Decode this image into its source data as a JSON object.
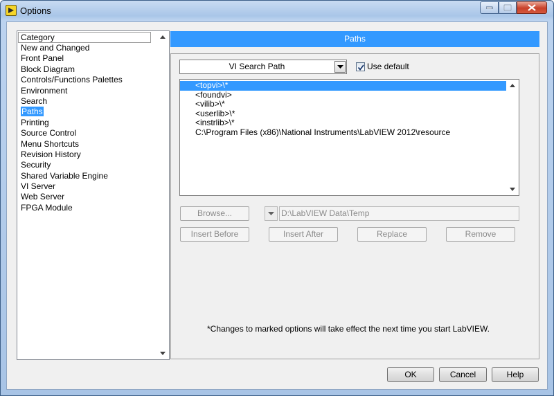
{
  "window": {
    "title": "Options"
  },
  "category": {
    "header": "Category",
    "items": [
      {
        "label": "New and Changed",
        "selected": false
      },
      {
        "label": "Front Panel",
        "selected": false
      },
      {
        "label": "Block Diagram",
        "selected": false
      },
      {
        "label": "Controls/Functions Palettes",
        "selected": false
      },
      {
        "label": "Environment",
        "selected": false
      },
      {
        "label": "Search",
        "selected": false
      },
      {
        "label": "Paths",
        "selected": true
      },
      {
        "label": "Printing",
        "selected": false
      },
      {
        "label": "Source Control",
        "selected": false
      },
      {
        "label": "Menu Shortcuts",
        "selected": false
      },
      {
        "label": "Revision History",
        "selected": false
      },
      {
        "label": "Security",
        "selected": false
      },
      {
        "label": "Shared Variable Engine",
        "selected": false
      },
      {
        "label": "VI Server",
        "selected": false
      },
      {
        "label": "Web Server",
        "selected": false
      },
      {
        "label": "FPGA Module",
        "selected": false
      }
    ]
  },
  "panel": {
    "title": "Paths",
    "path_type": "VI Search Path",
    "use_default_label": "Use default",
    "use_default_checked": true,
    "paths": [
      {
        "value": "<topvi>\\*",
        "selected": true
      },
      {
        "value": "<foundvi>",
        "selected": false
      },
      {
        "value": "<vilib>\\*",
        "selected": false
      },
      {
        "value": "<userlib>\\*",
        "selected": false
      },
      {
        "value": "<instrlib>\\*",
        "selected": false
      },
      {
        "value": "C:\\Program Files (x86)\\National Instruments\\LabVIEW 2012\\resource",
        "selected": false
      }
    ],
    "browse_label": "Browse...",
    "path_value": "D:\\LabVIEW Data\\Temp",
    "insert_before_label": "Insert Before",
    "insert_after_label": "Insert After",
    "replace_label": "Replace",
    "remove_label": "Remove",
    "note": "*Changes to marked options will take effect the next time you start LabVIEW."
  },
  "footer": {
    "ok_label": "OK",
    "cancel_label": "Cancel",
    "help_label": "Help"
  },
  "colors": {
    "selection": "#3399ff",
    "title_bar": "#a9c6e8",
    "close_button": "#c8412a"
  }
}
